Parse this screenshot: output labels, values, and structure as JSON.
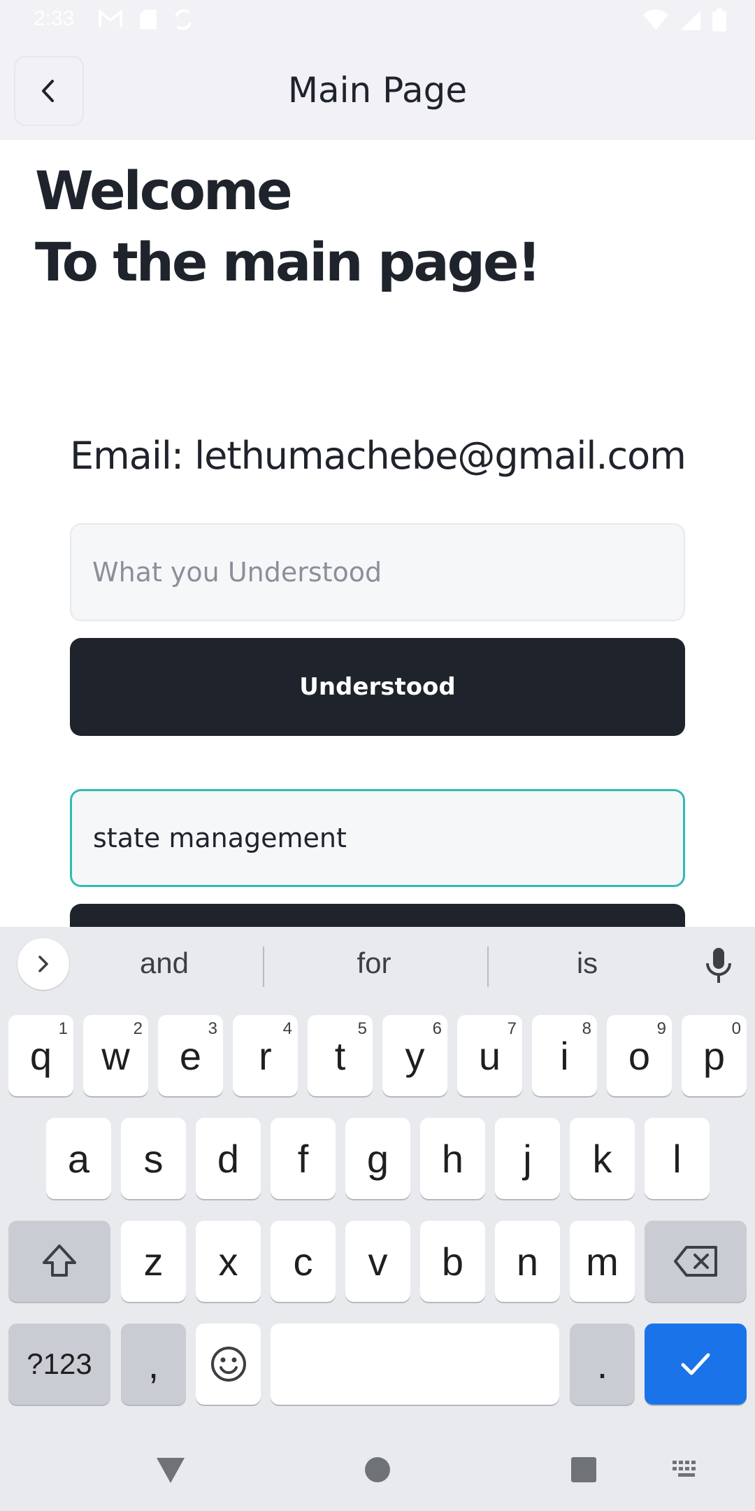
{
  "status_bar": {
    "time": "2:33",
    "left_icons": [
      "gmail-icon",
      "sd-card-icon",
      "sync-icon"
    ],
    "right_icons": [
      "wifi-icon",
      "signal-icon",
      "battery-icon"
    ]
  },
  "header": {
    "title": "Main Page",
    "back_icon": "chevron-left-icon"
  },
  "main": {
    "welcome_line1": "Welcome",
    "welcome_line2": "To the main page!",
    "email_text": "Email: lethumachebe@gmail.com",
    "field1": {
      "placeholder": "What you Understood",
      "value": ""
    },
    "button1_label": "Understood",
    "field2": {
      "placeholder": "",
      "value": "state management"
    }
  },
  "keyboard": {
    "suggestions": [
      "and",
      "for",
      "is"
    ],
    "row1": [
      {
        "key": "q",
        "hint": "1"
      },
      {
        "key": "w",
        "hint": "2"
      },
      {
        "key": "e",
        "hint": "3"
      },
      {
        "key": "r",
        "hint": "4"
      },
      {
        "key": "t",
        "hint": "5"
      },
      {
        "key": "y",
        "hint": "6"
      },
      {
        "key": "u",
        "hint": "7"
      },
      {
        "key": "i",
        "hint": "8"
      },
      {
        "key": "o",
        "hint": "9"
      },
      {
        "key": "p",
        "hint": "0"
      }
    ],
    "row2": [
      "a",
      "s",
      "d",
      "f",
      "g",
      "h",
      "j",
      "k",
      "l"
    ],
    "row3": [
      "z",
      "x",
      "c",
      "v",
      "b",
      "n",
      "m"
    ],
    "symbols_label": "?123",
    "comma_label": ",",
    "period_label": ".",
    "accent_color": "#1a73e8"
  },
  "nav": {
    "icons": [
      "back-triangle-icon",
      "home-circle-icon",
      "recents-square-icon",
      "keyboard-switch-icon"
    ]
  }
}
